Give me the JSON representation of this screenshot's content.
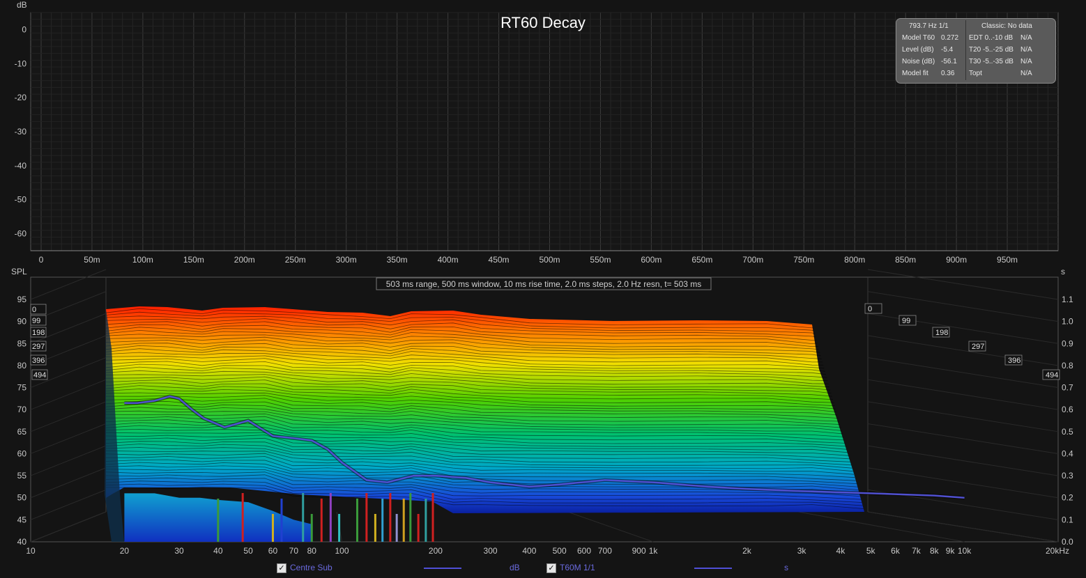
{
  "chart_data": [
    {
      "type": "line",
      "title": "RT60 Decay",
      "ylabel": "dB",
      "ylim": [
        -65,
        5
      ],
      "yticks": [
        0,
        -10,
        -20,
        -30,
        -40,
        -50,
        -60
      ],
      "xlim": [
        0,
        1
      ],
      "xticks": [
        {
          "v": 0,
          "label": "0"
        },
        {
          "v": 0.05,
          "label": "50m"
        },
        {
          "v": 0.1,
          "label": "100m"
        },
        {
          "v": 0.15,
          "label": "150m"
        },
        {
          "v": 0.2,
          "label": "200m"
        },
        {
          "v": 0.25,
          "label": "250m"
        },
        {
          "v": 0.3,
          "label": "300m"
        },
        {
          "v": 0.35,
          "label": "350m"
        },
        {
          "v": 0.4,
          "label": "400m"
        },
        {
          "v": 0.45,
          "label": "450m"
        },
        {
          "v": 0.5,
          "label": "500m"
        },
        {
          "v": 0.55,
          "label": "550m"
        },
        {
          "v": 0.6,
          "label": "600m"
        },
        {
          "v": 0.65,
          "label": "650m"
        },
        {
          "v": 0.7,
          "label": "700m"
        },
        {
          "v": 0.75,
          "label": "750m"
        },
        {
          "v": 0.8,
          "label": "800m"
        },
        {
          "v": 0.85,
          "label": "850m"
        },
        {
          "v": 0.9,
          "label": "900m"
        },
        {
          "v": 0.95,
          "label": "950m"
        }
      ],
      "grid": true,
      "series": []
    },
    {
      "type": "area",
      "subtitle": "503 ms range, 500 ms window, 10 ms rise time, 2.0 ms steps,  2.0 Hz resn, t= 503 ms",
      "ylabel": "SPL",
      "y2label": "s",
      "ylim": [
        40,
        95
      ],
      "yticks": [
        95,
        90,
        85,
        80,
        75,
        70,
        65,
        60,
        55,
        50,
        45,
        40
      ],
      "y2lim": [
        0,
        1.1
      ],
      "y2ticks": [
        "1.1",
        "1.0",
        "0.9",
        "0.8",
        "0.7",
        "0.6",
        "0.5",
        "0.4",
        "0.3",
        "0.2",
        "0.1",
        "0.0"
      ],
      "xscale": "log",
      "xlim": [
        10,
        20000
      ],
      "xticks": [
        {
          "v": 10,
          "label": "10"
        },
        {
          "v": 20,
          "label": "20"
        },
        {
          "v": 30,
          "label": "30"
        },
        {
          "v": 40,
          "label": "40"
        },
        {
          "v": 50,
          "label": "50"
        },
        {
          "v": 60,
          "label": "60"
        },
        {
          "v": 70,
          "label": "70"
        },
        {
          "v": 80,
          "label": "80"
        },
        {
          "v": 100,
          "label": "100"
        },
        {
          "v": 200,
          "label": "200"
        },
        {
          "v": 300,
          "label": "300"
        },
        {
          "v": 400,
          "label": "400"
        },
        {
          "v": 500,
          "label": "500"
        },
        {
          "v": 600,
          "label": "600"
        },
        {
          "v": 700,
          "label": "700"
        },
        {
          "v": 900,
          "label": "900"
        },
        {
          "v": 1000,
          "label": "1k"
        },
        {
          "v": 2000,
          "label": "2k"
        },
        {
          "v": 3000,
          "label": "3k"
        },
        {
          "v": 4000,
          "label": "4k"
        },
        {
          "v": 5000,
          "label": "5k"
        },
        {
          "v": 6000,
          "label": "6k"
        },
        {
          "v": 7000,
          "label": "7k"
        },
        {
          "v": 8000,
          "label": "8k"
        },
        {
          "v": 9000,
          "label": "9k"
        },
        {
          "v": 10000,
          "label": "10k"
        },
        {
          "v": 20000,
          "label": "20kHz"
        }
      ],
      "time_slice_labels": [
        "0",
        "99",
        "198",
        "297",
        "396",
        "494"
      ],
      "waterfall_front_spl": [
        {
          "f": 20,
          "spl": 51
        },
        {
          "f": 25,
          "spl": 51
        },
        {
          "f": 30,
          "spl": 50
        },
        {
          "f": 35,
          "spl": 50
        },
        {
          "f": 40,
          "spl": 49.5
        },
        {
          "f": 50,
          "spl": 49
        },
        {
          "f": 60,
          "spl": 47
        },
        {
          "f": 70,
          "spl": 45
        },
        {
          "f": 80,
          "spl": 44
        },
        {
          "f": 100,
          "spl": 44
        },
        {
          "f": 150,
          "spl": 44
        },
        {
          "f": 200,
          "spl": 44
        },
        {
          "f": 300,
          "spl": 44
        },
        {
          "f": 500,
          "spl": 44
        },
        {
          "f": 1000,
          "spl": 44
        },
        {
          "f": 2000,
          "spl": 44
        },
        {
          "f": 3000,
          "spl": 44
        },
        {
          "f": 4000,
          "spl": 44
        }
      ],
      "series": [
        {
          "name": "Centre Sub",
          "unit": "dB",
          "color": "#5a5ae0",
          "points": [
            {
              "f": 20,
              "spl": 90
            },
            {
              "f": 25,
              "spl": 92.5
            },
            {
              "f": 30,
              "spl": 90.5
            },
            {
              "f": 35,
              "spl": 86.5
            },
            {
              "f": 40,
              "spl": 89
            },
            {
              "f": 45,
              "spl": 88
            },
            {
              "f": 50,
              "spl": 87
            },
            {
              "f": 60,
              "spl": 87.5
            },
            {
              "f": 70,
              "spl": 88
            },
            {
              "f": 80,
              "spl": 85
            },
            {
              "f": 90,
              "spl": 84.5
            },
            {
              "f": 100,
              "spl": 86
            },
            {
              "f": 120,
              "spl": 84
            },
            {
              "f": 150,
              "spl": 82
            },
            {
              "f": 170,
              "spl": 85
            },
            {
              "f": 200,
              "spl": 89
            },
            {
              "f": 230,
              "spl": 89.5
            },
            {
              "f": 260,
              "spl": 86
            },
            {
              "f": 300,
              "spl": 85
            },
            {
              "f": 500,
              "spl": 84.5
            },
            {
              "f": 1000,
              "spl": 84.5
            },
            {
              "f": 2000,
              "spl": 84.5
            },
            {
              "f": 3000,
              "spl": 84
            },
            {
              "f": 4000,
              "spl": 83.5
            }
          ]
        },
        {
          "name": "T60M 1/1",
          "unit": "s",
          "color": "#5050d0",
          "points": [
            {
              "f": 20,
              "s": 0.63
            },
            {
              "f": 22,
              "s": 0.63
            },
            {
              "f": 25,
              "s": 0.64
            },
            {
              "f": 28,
              "s": 0.66
            },
            {
              "f": 30,
              "s": 0.65
            },
            {
              "f": 33,
              "s": 0.6
            },
            {
              "f": 36,
              "s": 0.56
            },
            {
              "f": 42,
              "s": 0.52
            },
            {
              "f": 50,
              "s": 0.55
            },
            {
              "f": 60,
              "s": 0.48
            },
            {
              "f": 70,
              "s": 0.47
            },
            {
              "f": 80,
              "s": 0.46
            },
            {
              "f": 90,
              "s": 0.42
            },
            {
              "f": 100,
              "s": 0.36
            },
            {
              "f": 120,
              "s": 0.28
            },
            {
              "f": 140,
              "s": 0.27
            },
            {
              "f": 170,
              "s": 0.3
            },
            {
              "f": 200,
              "s": 0.3
            },
            {
              "f": 250,
              "s": 0.29
            },
            {
              "f": 300,
              "s": 0.27
            },
            {
              "f": 400,
              "s": 0.25
            },
            {
              "f": 500,
              "s": 0.26
            },
            {
              "f": 700,
              "s": 0.28
            },
            {
              "f": 1000,
              "s": 0.27
            },
            {
              "f": 1500,
              "s": 0.25
            },
            {
              "f": 2000,
              "s": 0.24
            },
            {
              "f": 3000,
              "s": 0.23
            },
            {
              "f": 5000,
              "s": 0.22
            },
            {
              "f": 8000,
              "s": 0.21
            },
            {
              "f": 10000,
              "s": 0.2
            }
          ]
        }
      ]
    }
  ],
  "info_panel": {
    "header_left": "793.7 Hz 1/1",
    "header_right": "Classic: No data",
    "rows": [
      {
        "label": "Model T60",
        "value": "0.272",
        "label2": "EDT  0..-10 dB",
        "value2": "N/A"
      },
      {
        "label": "Level (dB)",
        "value": "-5.4",
        "label2": "T20 -5..-25 dB",
        "value2": "N/A"
      },
      {
        "label": "Noise (dB)",
        "value": "-56.1",
        "label2": "T30 -5..-35 dB",
        "value2": "N/A"
      },
      {
        "label": "Model fit",
        "value": "0.36",
        "label2": "Topt",
        "value2": "N/A"
      }
    ]
  },
  "legend": {
    "items": [
      {
        "name": "Centre Sub",
        "unit": "dB",
        "checked": true
      },
      {
        "name": "T60M 1/1",
        "unit": "s",
        "checked": true
      }
    ],
    "check_glyph": "✓"
  },
  "colors": {
    "background": "#141414",
    "grid": "#3a3a3a",
    "series": "#5a5ae0"
  }
}
